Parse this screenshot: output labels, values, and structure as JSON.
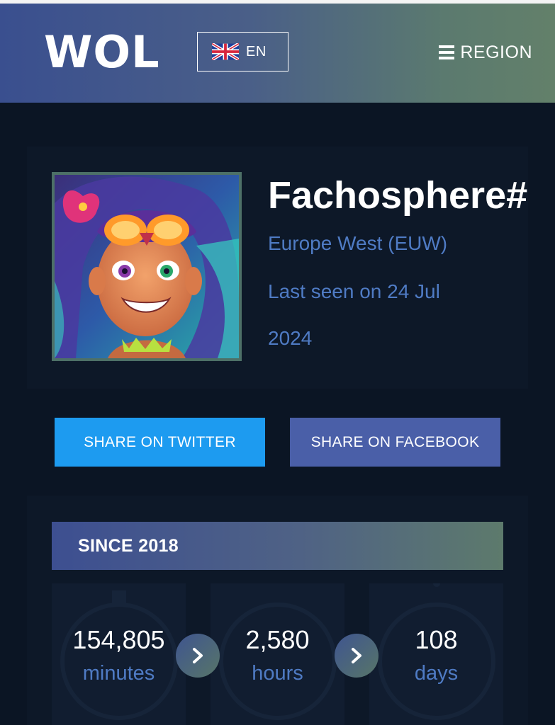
{
  "header": {
    "logo": "WOL",
    "language": {
      "code": "EN",
      "flag_icon": "uk-flag-icon"
    },
    "region_label": "REGION",
    "menu_icon": "hamburger-icon"
  },
  "profile": {
    "name": "Fachosphere#",
    "server": "Europe West (EUW)",
    "last_seen_line1": "Last seen on 24 Jul",
    "last_seen_line2": "2024",
    "avatar_icon": "summoner-avatar-icon"
  },
  "share": {
    "twitter_label": "SHARE ON TWITTER",
    "facebook_label": "SHARE ON FACEBOOK"
  },
  "stats": {
    "since_label": "SINCE 2018",
    "items": [
      {
        "value": "154,805",
        "unit": "minutes"
      },
      {
        "value": "2,580",
        "unit": "hours"
      },
      {
        "value": "108",
        "unit": "days"
      }
    ],
    "arrow_icon": "chevron-right-icon"
  },
  "colors": {
    "background": "#0b1524",
    "accent_text": "#4f7bc4",
    "twitter": "#1d9bf0",
    "facebook": "#4a5fa8"
  }
}
